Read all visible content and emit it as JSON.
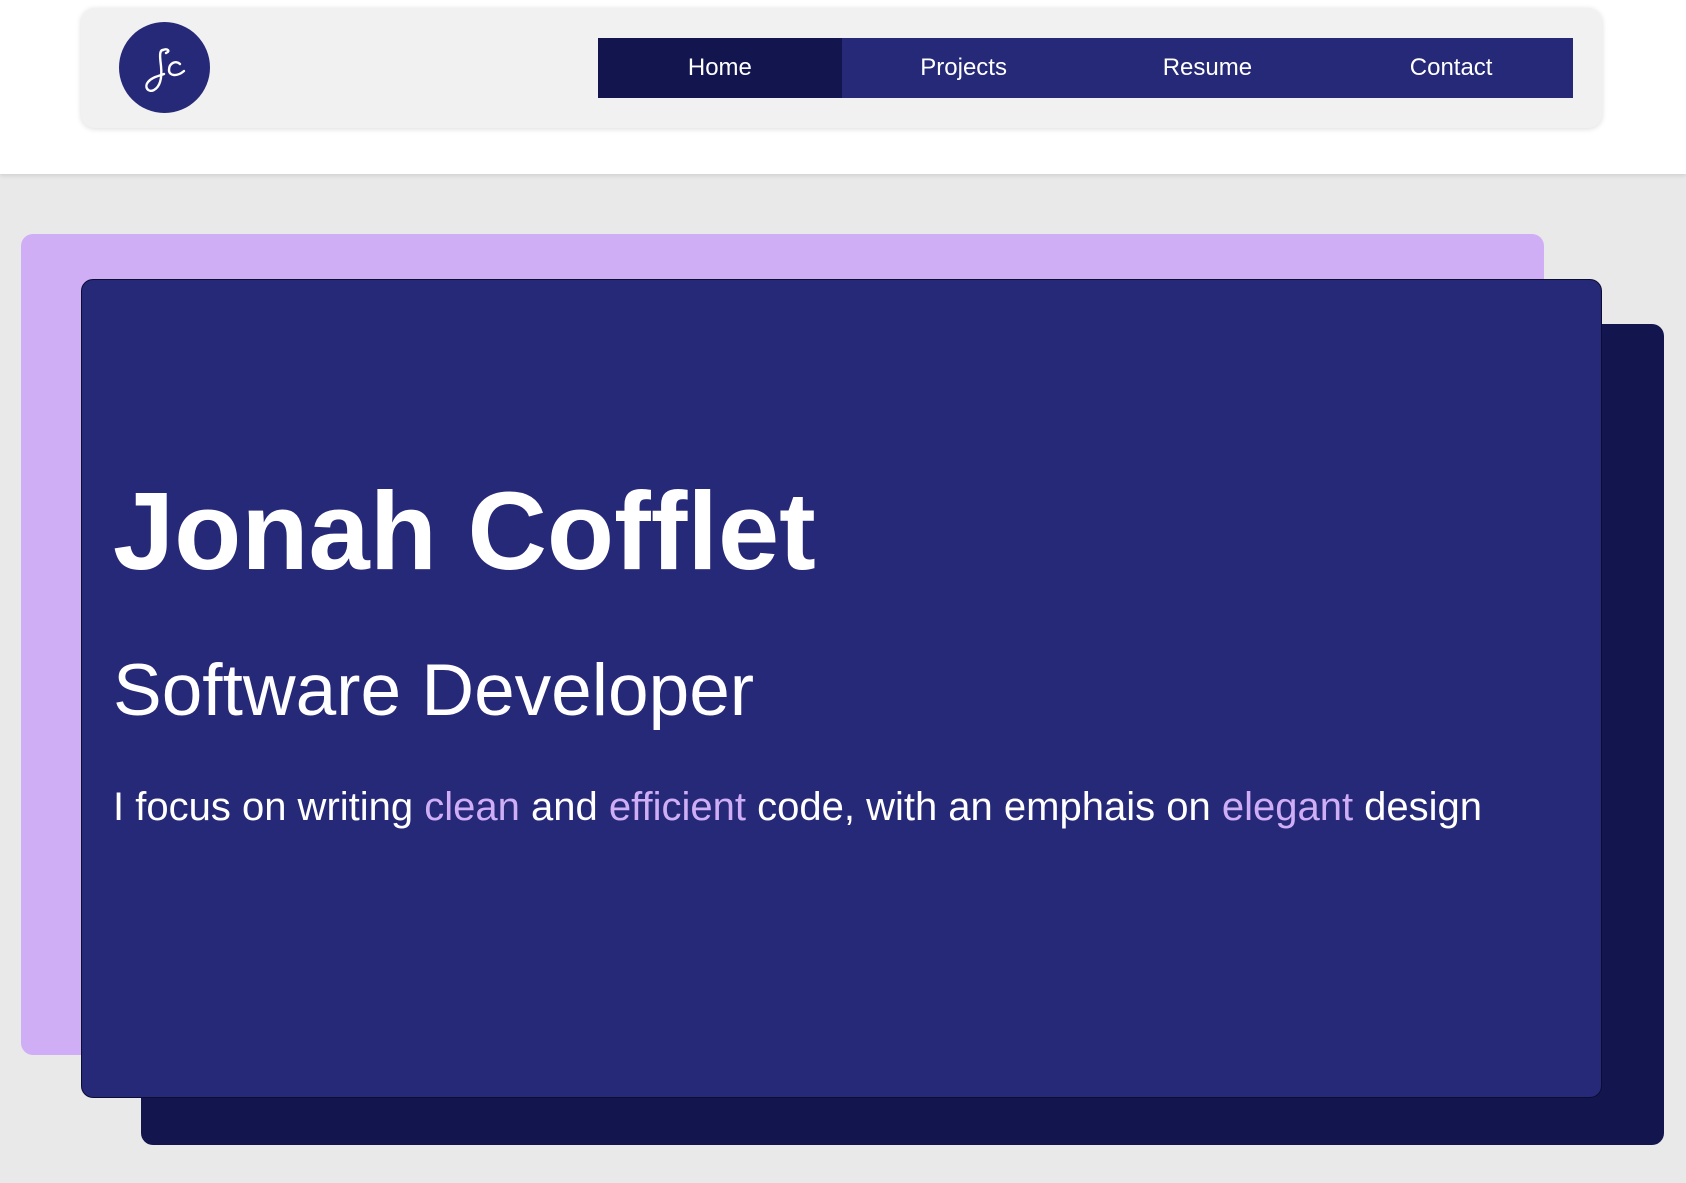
{
  "header": {
    "logo_text": "Jc",
    "nav": [
      {
        "label": "Home",
        "active": true
      },
      {
        "label": "Projects",
        "active": false
      },
      {
        "label": "Resume",
        "active": false
      },
      {
        "label": "Contact",
        "active": false
      }
    ]
  },
  "hero": {
    "name": "Jonah Cofflet",
    "title": "Software Developer",
    "tagline": {
      "part1": "I focus on writing ",
      "word1": "clean",
      "part2": " and ",
      "word2": "efficient",
      "part3": " code, with an emphais on ",
      "word3": "elegant",
      "part4": " design"
    }
  },
  "colors": {
    "page_bg": "#e9e9e9",
    "header_card": "#f1f1f1",
    "primary_navy": "#262878",
    "dark_navy": "#13154f",
    "lilac_accent": "#cfaef6",
    "text_white": "#ffffff"
  }
}
